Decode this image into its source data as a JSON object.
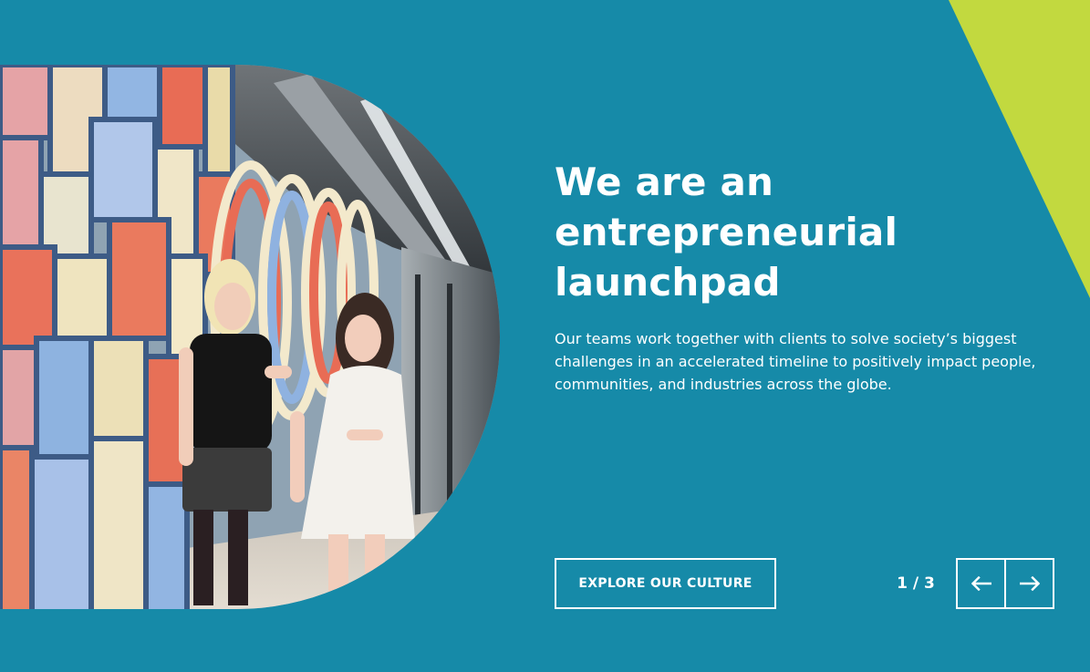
{
  "hero": {
    "headline": "We are an entrepreneurial launchpad",
    "body": "Our teams work together with clients to solve society’s biggest challenges in an accelerated timeline to positively impact people, communities, and industries across the globe.",
    "cta_label": "EXPLORE OUR CULTURE",
    "image_alt": "Two colleagues walking and talking in a colorful office corridor"
  },
  "carousel": {
    "counter": "1 / 3",
    "prev_icon": "arrow-left-icon",
    "next_icon": "arrow-right-icon"
  },
  "colors": {
    "background": "#168aa8",
    "accent_green": "#c2d93f",
    "text": "#ffffff"
  }
}
